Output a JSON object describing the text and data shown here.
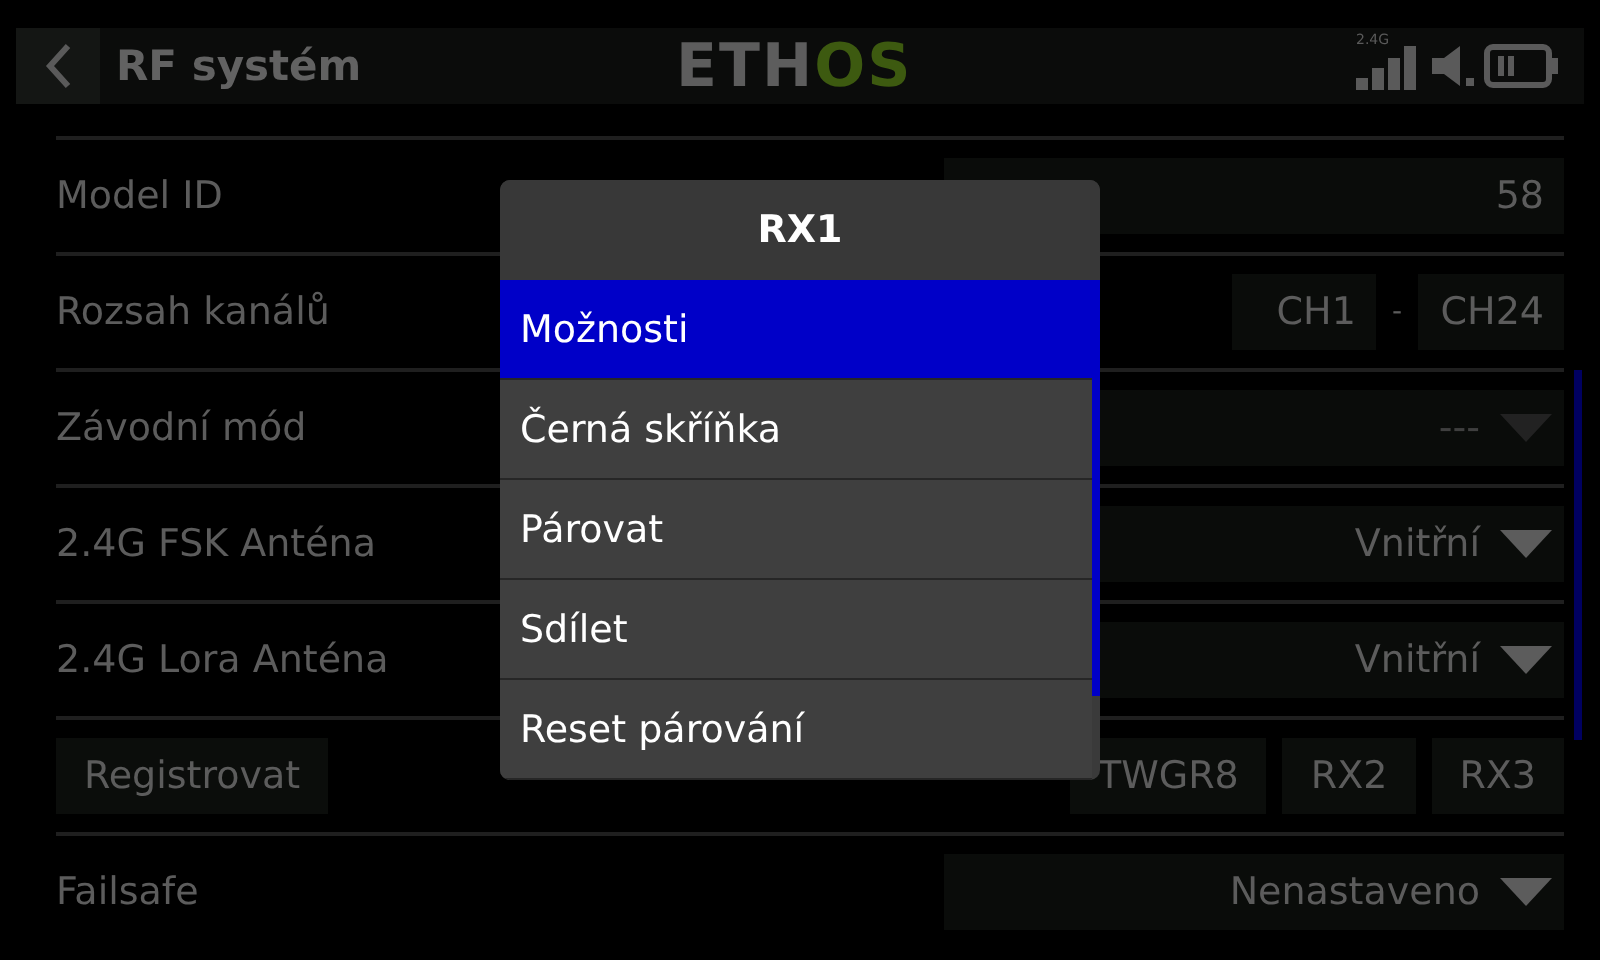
{
  "header": {
    "title": "RF systém",
    "logo": [
      "ETH",
      "OS"
    ],
    "band": "2.4G"
  },
  "rows": [
    {
      "kind": "number",
      "label": "Model ID",
      "value": "58"
    },
    {
      "kind": "range",
      "label": "Rozsah kanálů",
      "from": "CH1",
      "separator": "-",
      "to": "CH24"
    },
    {
      "kind": "dropdown",
      "label": "Závodní mód",
      "value": "---",
      "disabled": true
    },
    {
      "kind": "dropdown",
      "label": "2.4G FSK Anténa",
      "value": "Vnitřní",
      "disabled": false
    },
    {
      "kind": "dropdown",
      "label": "2.4G Lora Anténa",
      "value": "Vnitřní",
      "disabled": false
    },
    {
      "kind": "buttons",
      "label": "Registrovat",
      "buttons": [
        "TWGR8",
        "RX2",
        "RX3"
      ]
    },
    {
      "kind": "dropdown",
      "label": "Failsafe",
      "value": "Nenastaveno",
      "disabled": false
    }
  ],
  "menu": {
    "title": "RX1",
    "items": [
      {
        "label": "Možnosti",
        "selected": true
      },
      {
        "label": "Černá skříňka",
        "selected": false
      },
      {
        "label": "Párovat",
        "selected": false
      },
      {
        "label": "Sdílet",
        "selected": false
      },
      {
        "label": "Reset párování",
        "selected": false
      }
    ]
  }
}
